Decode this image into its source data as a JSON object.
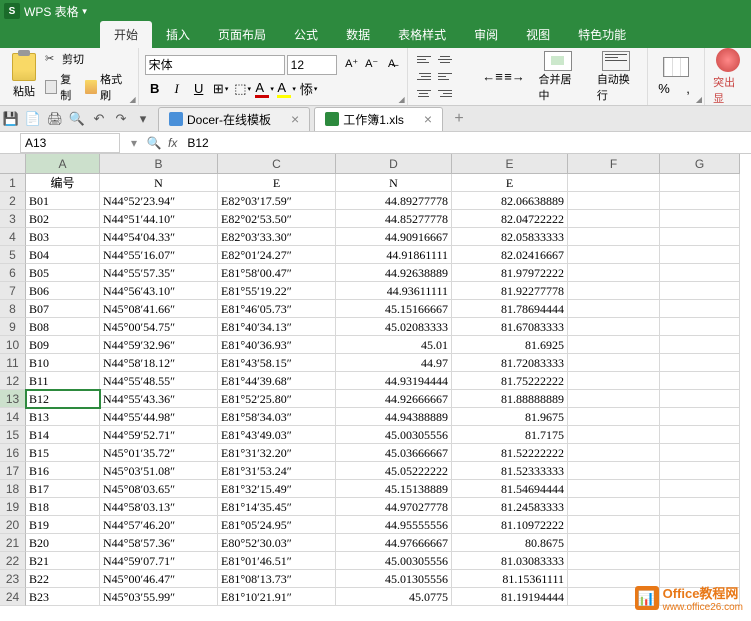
{
  "app": {
    "icon": "S",
    "title": "WPS 表格"
  },
  "menu": {
    "tabs": [
      "开始",
      "插入",
      "页面布局",
      "公式",
      "数据",
      "表格样式",
      "审阅",
      "视图",
      "特色功能"
    ],
    "active_index": 0
  },
  "ribbon": {
    "paste": "粘贴",
    "cut": "剪切",
    "copy": "复制",
    "format_painter": "格式刷",
    "font_name": "宋体",
    "font_size": "12",
    "bold": "B",
    "italic": "I",
    "underline": "U",
    "inc_size": "A⁺",
    "dec_size": "A⁻",
    "merge": "合并居中",
    "wrap": "自动换行",
    "percent": "%",
    "red_action": "突出显"
  },
  "quick_access": {
    "icons": [
      "save",
      "save-as",
      "print",
      "print-preview",
      "undo",
      "redo"
    ]
  },
  "doc_tabs": [
    {
      "label": "Docer-在线模板",
      "icon": "docer",
      "active": false
    },
    {
      "label": "工作簿1.xls",
      "icon": "xls",
      "active": true
    }
  ],
  "name_box": "A13",
  "formula_bar": "B12",
  "columns": [
    "A",
    "B",
    "C",
    "D",
    "E",
    "F",
    "G"
  ],
  "active_cell_row": 13,
  "active_cell_col": 0,
  "chart_data": {
    "type": "table",
    "headers": [
      "编号",
      "N",
      "E",
      "N",
      "E",
      "",
      ""
    ],
    "rows": [
      [
        "B01",
        "N44°52′23.94″",
        "E82°03′17.59″",
        "44.89277778",
        "82.06638889",
        "",
        ""
      ],
      [
        "B02",
        "N44°51′44.10″",
        "E82°02′53.50″",
        "44.85277778",
        "82.04722222",
        "",
        ""
      ],
      [
        "B03",
        "N44°54′04.33″",
        "E82°03′33.30″",
        "44.90916667",
        "82.05833333",
        "",
        ""
      ],
      [
        "B04",
        "N44°55′16.07″",
        "E82°01′24.27″",
        "44.91861111",
        "82.02416667",
        "",
        ""
      ],
      [
        "B05",
        "N44°55′57.35″",
        "E81°58′00.47″",
        "44.92638889",
        "81.97972222",
        "",
        ""
      ],
      [
        "B06",
        "N44°56′43.10″",
        "E81°55′19.22″",
        "44.93611111",
        "81.92277778",
        "",
        ""
      ],
      [
        "B07",
        "N45°08′41.66″",
        "E81°46′05.73″",
        "45.15166667",
        "81.78694444",
        "",
        ""
      ],
      [
        "B08",
        "N45°00′54.75″",
        "E81°40′34.13″",
        "45.02083333",
        "81.67083333",
        "",
        ""
      ],
      [
        "B09",
        "N44°59′32.96″",
        "E81°40′36.93″",
        "45.01",
        "81.6925",
        "",
        ""
      ],
      [
        "B10",
        "N44°58′18.12″",
        "E81°43′58.15″",
        "44.97",
        "81.72083333",
        "",
        ""
      ],
      [
        "B11",
        "N44°55′48.55″",
        "E81°44′39.68″",
        "44.93194444",
        "81.75222222",
        "",
        ""
      ],
      [
        "B12",
        "N44°55′43.36″",
        "E81°52′25.80″",
        "44.92666667",
        "81.88888889",
        "",
        ""
      ],
      [
        "B13",
        "N44°55′44.98″",
        "E81°58′34.03″",
        "44.94388889",
        "81.9675",
        "",
        ""
      ],
      [
        "B14",
        "N44°59′52.71″",
        "E81°43′49.03″",
        "45.00305556",
        "81.7175",
        "",
        ""
      ],
      [
        "B15",
        "N45°01′35.72″",
        "E81°31′32.20″",
        "45.03666667",
        "81.52222222",
        "",
        ""
      ],
      [
        "B16",
        "N45°03′51.08″",
        "E81°31′53.24″",
        "45.05222222",
        "81.52333333",
        "",
        ""
      ],
      [
        "B17",
        "N45°08′03.65″",
        "E81°32′15.49″",
        "45.15138889",
        "81.54694444",
        "",
        ""
      ],
      [
        "B18",
        "N44°58′03.13″",
        "E81°14′35.45″",
        "44.97027778",
        "81.24583333",
        "",
        ""
      ],
      [
        "B19",
        "N44°57′46.20″",
        "E81°05′24.95″",
        "44.95555556",
        "81.10972222",
        "",
        ""
      ],
      [
        "B20",
        "N44°58′57.36″",
        "E80°52′30.03″",
        "44.97666667",
        "80.8675",
        "",
        ""
      ],
      [
        "B21",
        "N44°59′07.71″",
        "E81°01′46.51″",
        "45.00305556",
        "81.03083333",
        "",
        ""
      ],
      [
        "B22",
        "N45°00′46.47″",
        "E81°08′13.73″",
        "45.01305556",
        "81.15361111",
        "",
        ""
      ],
      [
        "B23",
        "N45°03′55.99″",
        "E81°10′21.91″",
        "45.0775",
        "81.19194444",
        "",
        ""
      ]
    ]
  },
  "watermark": {
    "title": "Office教程网",
    "sub": "www.office26.com"
  }
}
